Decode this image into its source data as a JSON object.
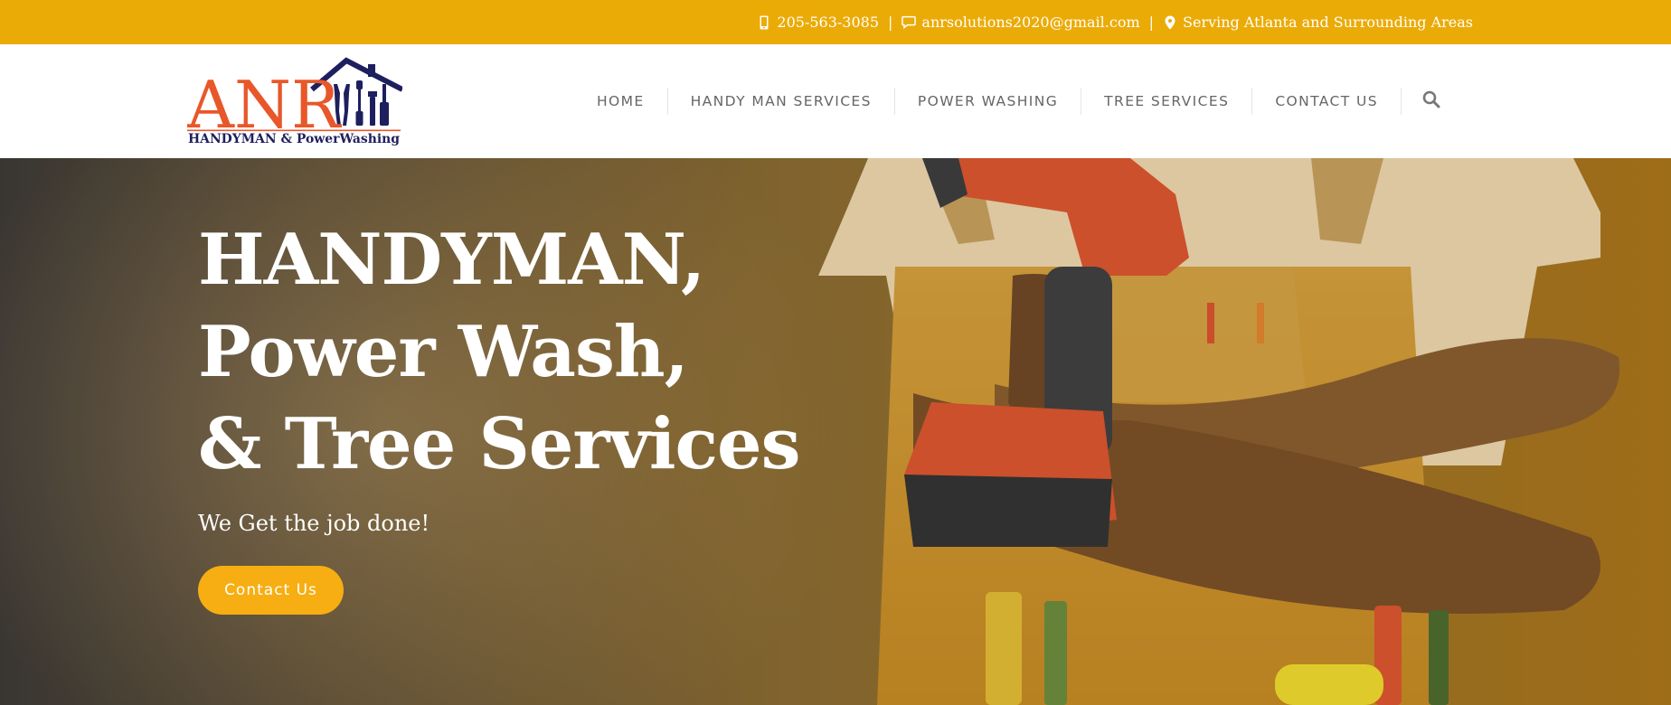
{
  "topbar": {
    "phone": "205-563-3085",
    "email": "anrsolutions2020@gmail.com",
    "location": "Serving Atlanta and Surrounding Areas",
    "separator": "|"
  },
  "logo": {
    "letters": "ANR",
    "tagline": "HANDYMAN & PowerWashing"
  },
  "nav": {
    "items": [
      {
        "label": "HOME"
      },
      {
        "label": "HANDY MAN SERVICES"
      },
      {
        "label": "POWER WASHING"
      },
      {
        "label": "TREE SERVICES"
      },
      {
        "label": "CONTACT US"
      }
    ]
  },
  "hero": {
    "title_lines": [
      "HANDYMAN,",
      "Power Wash,",
      "& Tree Services"
    ],
    "subtitle": "We Get the job done!",
    "cta_label": "Contact Us"
  },
  "colors": {
    "accent": "#EBAB07",
    "button": "#F6AE12",
    "logo_orange": "#E8572A",
    "logo_navy": "#1E1F5E"
  }
}
